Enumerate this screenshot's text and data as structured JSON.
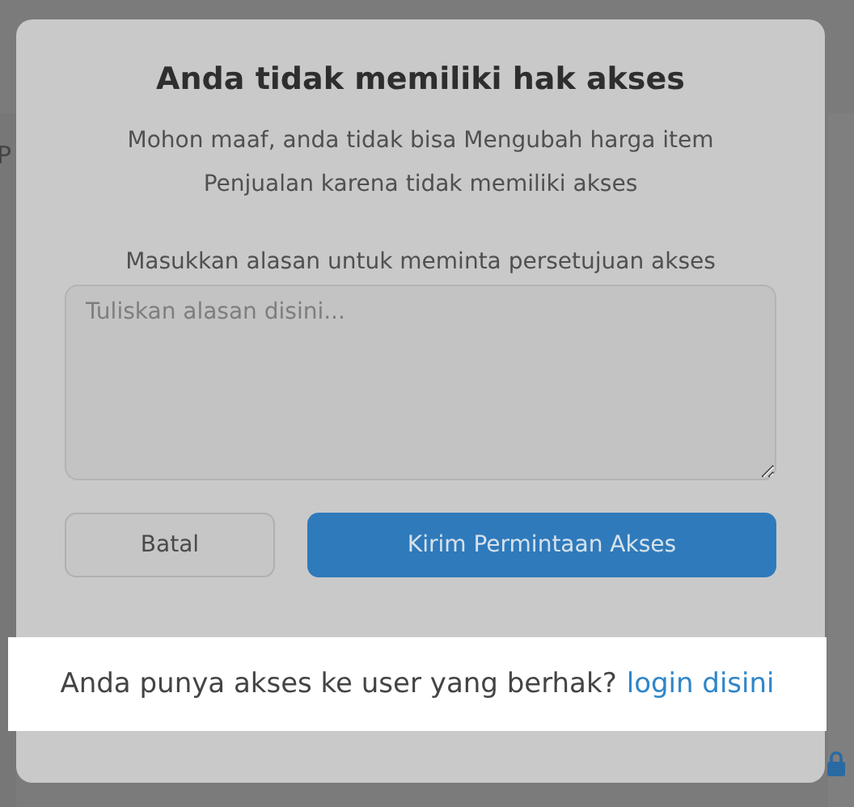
{
  "page_behind": {
    "heading_fragment": "P"
  },
  "dialog": {
    "title": "Anda tidak memiliki hak akses",
    "message_lines": [
      "Mohon maaf, anda tidak bisa Mengubah harga item",
      "Penjualan karena tidak memiliki akses"
    ],
    "reason_label": "Masukkan alasan untuk meminta persetujuan akses",
    "reason_field": {
      "placeholder": "Tuliskan alasan disini..."
    },
    "buttons": [
      {
        "label": "Batal",
        "kind": "secondary"
      },
      {
        "label": "Kirim Permintaan Akses",
        "kind": "primary"
      }
    ]
  },
  "callout": {
    "text": "Anda punya akses ke user yang berhak?",
    "link": "login disini"
  }
}
